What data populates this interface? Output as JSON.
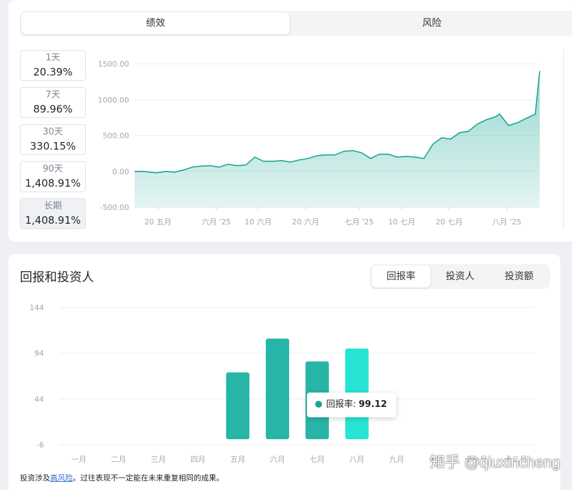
{
  "tabs_top": [
    {
      "label": "绩效",
      "active": true
    },
    {
      "label": "风险",
      "active": false
    }
  ],
  "periods": [
    {
      "label": "1天",
      "value": "20.39%"
    },
    {
      "label": "7天",
      "value": "89.96%"
    },
    {
      "label": "30天",
      "value": "330.15%"
    },
    {
      "label": "90天",
      "value": "1,408.91%"
    },
    {
      "label": "长期",
      "value": "1,408.91%",
      "active": true
    }
  ],
  "chart_data": [
    {
      "type": "area",
      "yticks": [
        "1500.00",
        "1000.00",
        "500.00",
        "0.00",
        "-500.00"
      ],
      "ylim": [
        -500,
        1500
      ],
      "xticks": [
        "20 五月",
        "六月 '25",
        "10 六月",
        "20 六月",
        "七月 '25",
        "10 七月",
        "20 七月",
        "八月 '25"
      ],
      "x": [
        "5-10",
        "5-12",
        "5-15",
        "5-17",
        "5-19",
        "5-21",
        "5-23",
        "5-25",
        "5-27",
        "5-29",
        "5-31",
        "6-02",
        "6-04",
        "6-06",
        "6-08",
        "6-10",
        "6-12",
        "6-14",
        "6-16",
        "6-18",
        "6-20",
        "6-22",
        "6-24",
        "6-26",
        "6-28",
        "6-30",
        "7-02",
        "7-04",
        "7-06",
        "7-08",
        "7-10",
        "7-12",
        "7-14",
        "7-16",
        "7-18",
        "7-20",
        "7-22",
        "7-24",
        "7-26",
        "7-28",
        "7-30",
        "7-31",
        "8-02",
        "8-04",
        "8-06",
        "8-08",
        "8-09"
      ],
      "values": [
        0,
        0,
        -20,
        0,
        -10,
        20,
        60,
        75,
        80,
        60,
        100,
        80,
        90,
        200,
        140,
        140,
        150,
        130,
        160,
        180,
        220,
        230,
        230,
        280,
        290,
        260,
        180,
        240,
        240,
        200,
        210,
        200,
        180,
        380,
        470,
        450,
        540,
        560,
        660,
        720,
        760,
        800,
        640,
        680,
        740,
        800,
        1400
      ],
      "color": "#17a693"
    },
    {
      "type": "bar",
      "yticks": [
        "144",
        "94",
        "44",
        "-6"
      ],
      "ylim": [
        -6,
        144
      ],
      "categories": [
        "一月",
        "二月",
        "三月",
        "四月",
        "五月",
        "六月",
        "七月",
        "八月",
        "九月",
        "十月",
        "十一月",
        "十二月"
      ],
      "values": [
        null,
        null,
        null,
        null,
        73,
        110,
        85,
        99.12,
        null,
        null,
        null,
        null
      ],
      "colors": [
        "#27b5a8",
        "#27b5a8",
        "#27b5a8",
        "#27b5a8",
        "#27b5a8",
        "#27b5a8",
        "#27b5a8",
        "#28e4d4",
        "#27b5a8",
        "#27b5a8",
        "#27b5a8",
        "#27b5a8"
      ]
    }
  ],
  "section_title": "回报和投资人",
  "tabs_bottom": [
    {
      "label": "回报率",
      "active": true
    },
    {
      "label": "投资人",
      "active": false
    },
    {
      "label": "投资额",
      "active": false
    }
  ],
  "tooltip": {
    "label": "回报率:",
    "value": "99.12"
  },
  "footer": {
    "prefix": "投资涉及",
    "link": "高风险",
    "suffix": "。过往表现不一定能在未来重复相同的成果。"
  },
  "watermark": "知乎 @qiuxincheng"
}
